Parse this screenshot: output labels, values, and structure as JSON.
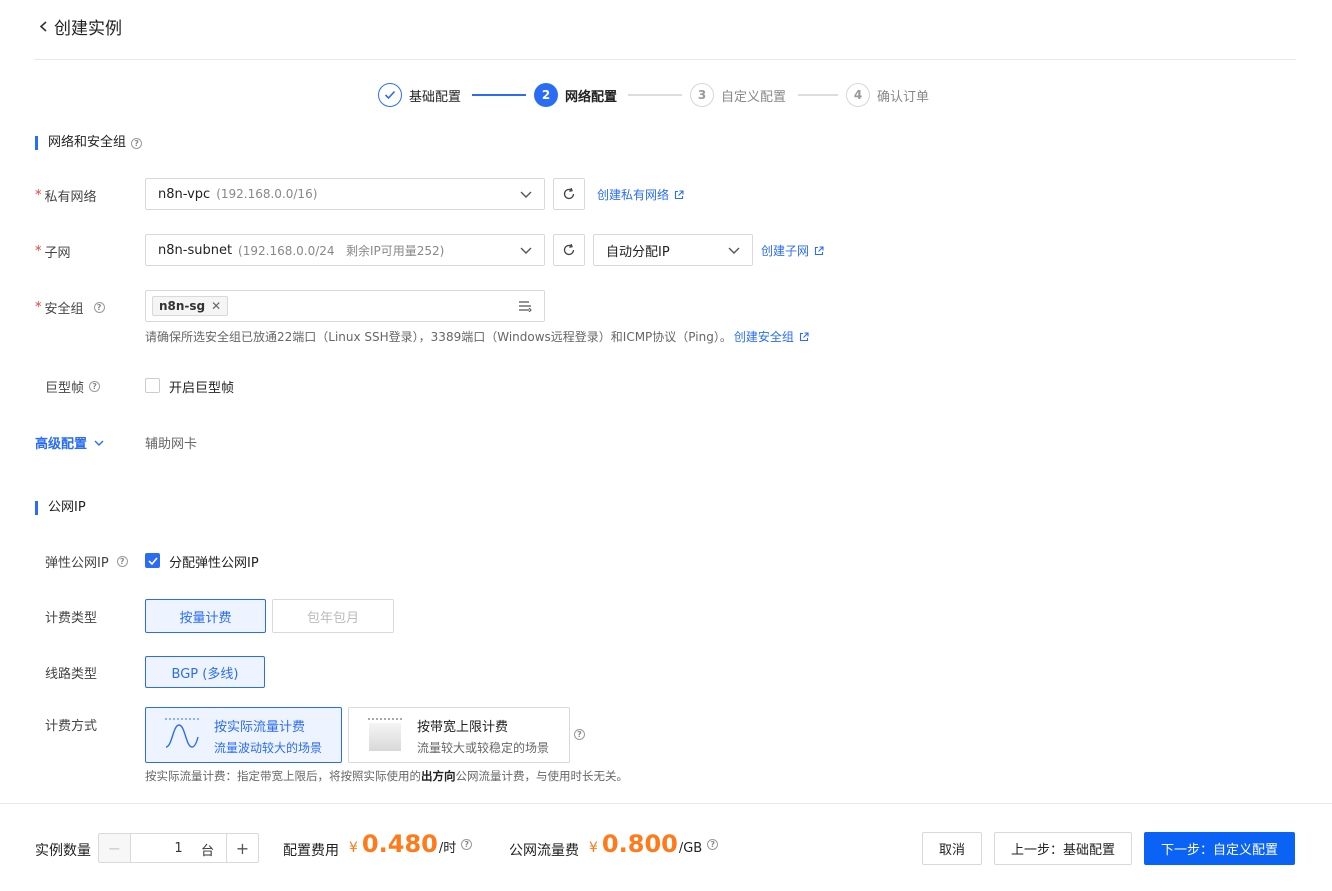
{
  "header": {
    "title": "创建实例"
  },
  "steps": [
    {
      "number": "✓",
      "label": "基础配置"
    },
    {
      "number": "2",
      "label": "网络配置"
    },
    {
      "number": "3",
      "label": "自定义配置"
    },
    {
      "number": "4",
      "label": "确认订单"
    }
  ],
  "network_section": {
    "title": "网络和安全组"
  },
  "vpc": {
    "label": "私有网络",
    "value": "n8n-vpc",
    "hint": "(192.168.0.0/16)",
    "create_link": "创建私有网络"
  },
  "subnet": {
    "label": "子网",
    "value": "n8n-subnet",
    "hint": "(192.168.0.0/24   剩余IP可用量252)",
    "ip_mode": "自动分配IP",
    "create_link": "创建子网"
  },
  "security_group": {
    "label": "安全组",
    "tag": "n8n-sg",
    "note": "请确保所选安全组已放通22端口（Linux SSH登录），3389端口（Windows远程登录）和ICMP协议（Ping）。",
    "create_link": "创建安全组"
  },
  "jumbo_frame": {
    "label": "巨型帧",
    "checkbox_label": "开启巨型帧"
  },
  "advanced": {
    "label": "高级配置",
    "sub": "辅助网卡"
  },
  "public_ip_section": {
    "title": "公网IP"
  },
  "eip": {
    "label": "弹性公网IP",
    "checkbox_label": "分配弹性公网IP"
  },
  "billing_type": {
    "label": "计费类型",
    "options": [
      "按量计费",
      "包年包月"
    ]
  },
  "line_type": {
    "label": "线路类型",
    "options": [
      "BGP (多线)"
    ]
  },
  "billing_method": {
    "label": "计费方式",
    "options": [
      {
        "title": "按实际流量计费",
        "sub": "流量波动较大的场景"
      },
      {
        "title": "按带宽上限计费",
        "sub": "流量较大或较稳定的场景"
      }
    ],
    "note_prefix": "按实际流量计费：指定带宽上限后，将按照实际使用的",
    "note_bold": "出方向",
    "note_suffix": "公网流量计费，与使用时长无关。"
  },
  "footer": {
    "quantity_label": "实例数量",
    "quantity": "1",
    "quantity_unit": "台",
    "config_fee_label": "配置费用",
    "currency": "¥",
    "config_fee": "0.480",
    "config_fee_unit": "/时",
    "traffic_fee_label": "公网流量费",
    "traffic_fee": "0.800",
    "traffic_fee_unit": "/GB",
    "cancel": "取消",
    "prev": "上一步：基础配置",
    "next": "下一步：自定义配置"
  },
  "colors": {
    "primary": "#2a6df4",
    "price": "#ff7a1a",
    "required": "#e53935"
  }
}
